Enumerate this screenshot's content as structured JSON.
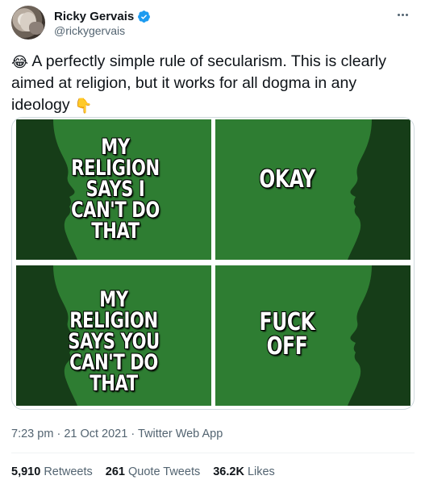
{
  "author": {
    "display_name": "Ricky Gervais",
    "handle": "@rickygervais",
    "verified": true
  },
  "tweet": {
    "emoji_start": "😂",
    "text": "A perfectly simple rule of secularism. This is clearly aimed at religion, but it works for all dogma in any ideology",
    "emoji_end": "👇"
  },
  "media": {
    "panels": [
      {
        "text_lines": [
          "MY RELIGION",
          "SAYS I",
          "CAN'T DO",
          "THAT"
        ]
      },
      {
        "text_lines": [
          "OKAY"
        ]
      },
      {
        "text_lines": [
          "MY RELIGION",
          "SAYS YOU",
          "CAN'T DO",
          "THAT"
        ]
      },
      {
        "text_lines": [
          "FUCK",
          "OFF"
        ]
      }
    ]
  },
  "meta": {
    "time": "7:23 pm",
    "date": "21 Oct 2021",
    "source": "Twitter Web App",
    "separator": "·"
  },
  "stats": {
    "retweets_count": "5,910",
    "retweets_label": "Retweets",
    "quotes_count": "261",
    "quotes_label": "Quote Tweets",
    "likes_count": "36.2K",
    "likes_label": "Likes"
  },
  "colors": {
    "verified_blue": "#1d9bf0",
    "panel_green": "#2e7d32",
    "silhouette": "#163d18",
    "secondary_text": "#536471"
  }
}
